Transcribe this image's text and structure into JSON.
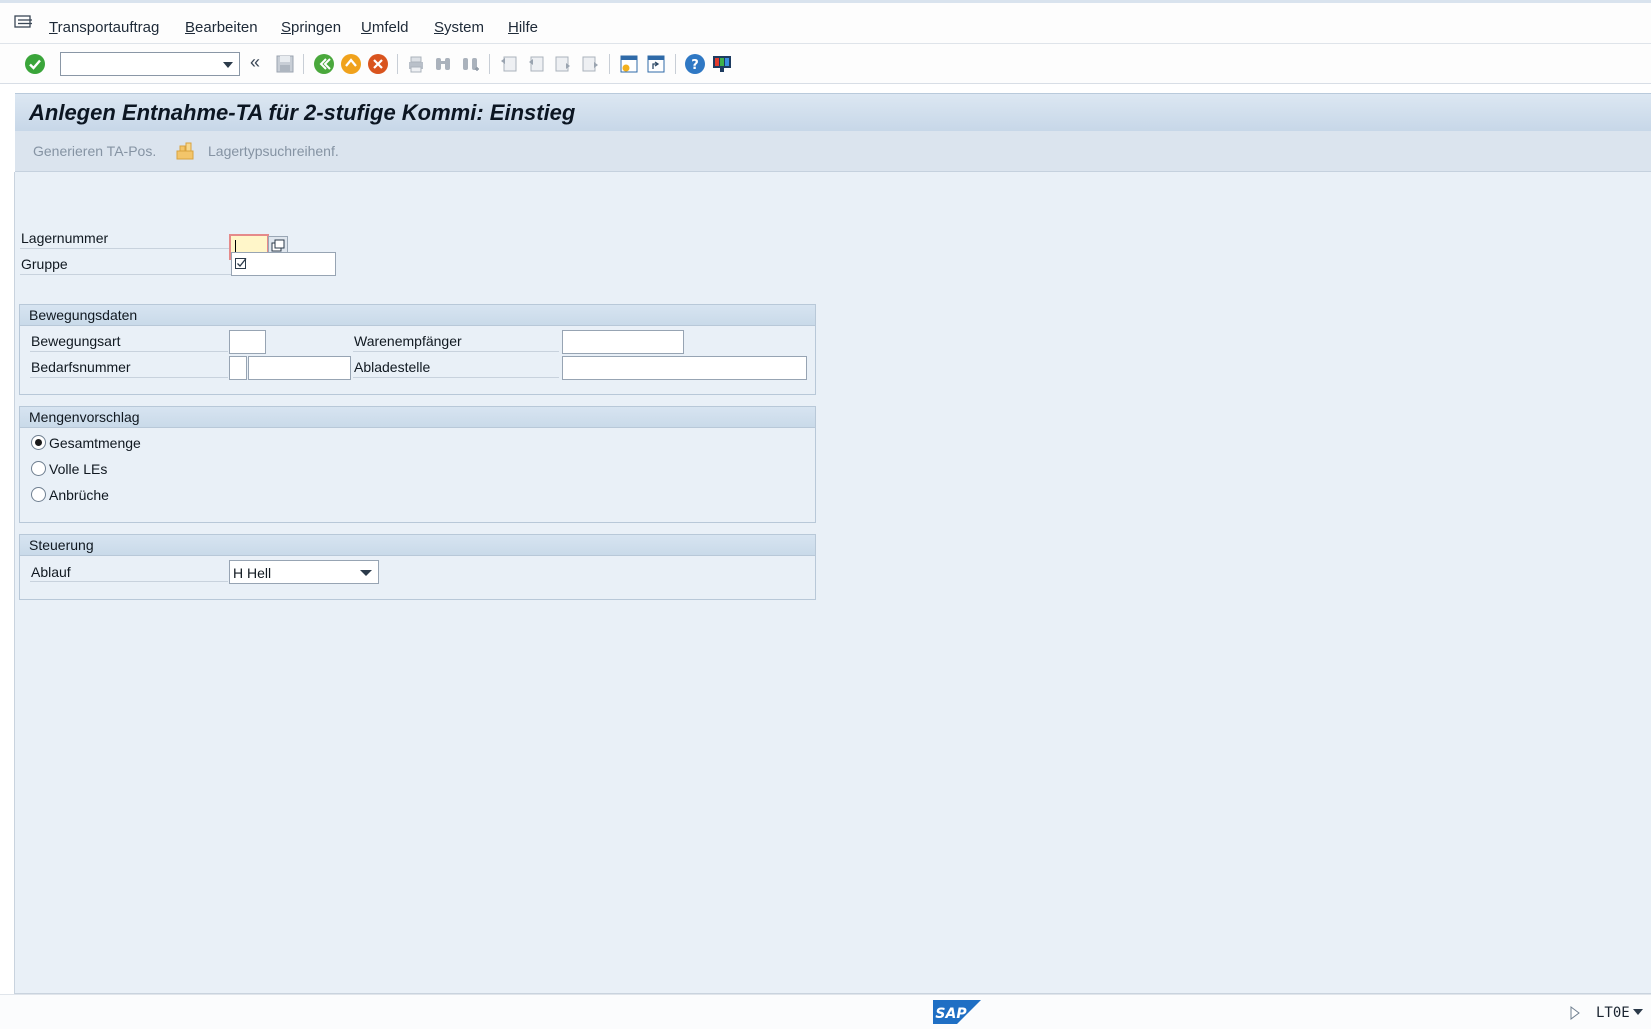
{
  "menu": {
    "items": [
      {
        "u": "T",
        "rest": "ransportauftrag"
      },
      {
        "u": "B",
        "rest": "earbeiten"
      },
      {
        "u": "S",
        "rest": "pringen"
      },
      {
        "u": "U",
        "rest": "mfeld"
      },
      {
        "u": "S",
        "rest": "ystem"
      },
      {
        "u": "H",
        "rest": "ilfe"
      }
    ]
  },
  "toolbar": {
    "command_value": "",
    "back_glyph": "«"
  },
  "title": "Anlegen Entnahme-TA für 2-stufige Kommi: Einstieg",
  "appbar": {
    "generate_label": "Generieren TA-Pos.",
    "storage_search_label": "Lagertypsuchreihenf."
  },
  "header_fields": {
    "warehouse_label": "Lagernummer",
    "warehouse_value": "",
    "group_label": "Gruppe",
    "group_value": ""
  },
  "movement": {
    "title": "Bewegungsdaten",
    "movement_type_label": "Bewegungsart",
    "requirement_number_label": "Bedarfsnummer",
    "ship_to_label": "Warenempfänger",
    "unloading_point_label": "Abladestelle"
  },
  "quantity": {
    "title": "Mengenvorschlag",
    "options": [
      "Gesamtmenge",
      "Volle LEs",
      "Anbrüche"
    ],
    "selected": "Gesamtmenge"
  },
  "control": {
    "title": "Steuerung",
    "process_label": "Ablauf",
    "process_value": "H Hell"
  },
  "status": {
    "logo_text": "SAP",
    "transaction": "LT0E"
  },
  "colors": {
    "accent_blue": "#2f78c4",
    "title_bg": "#c7d7e8",
    "content_bg": "#e9f0f7"
  }
}
